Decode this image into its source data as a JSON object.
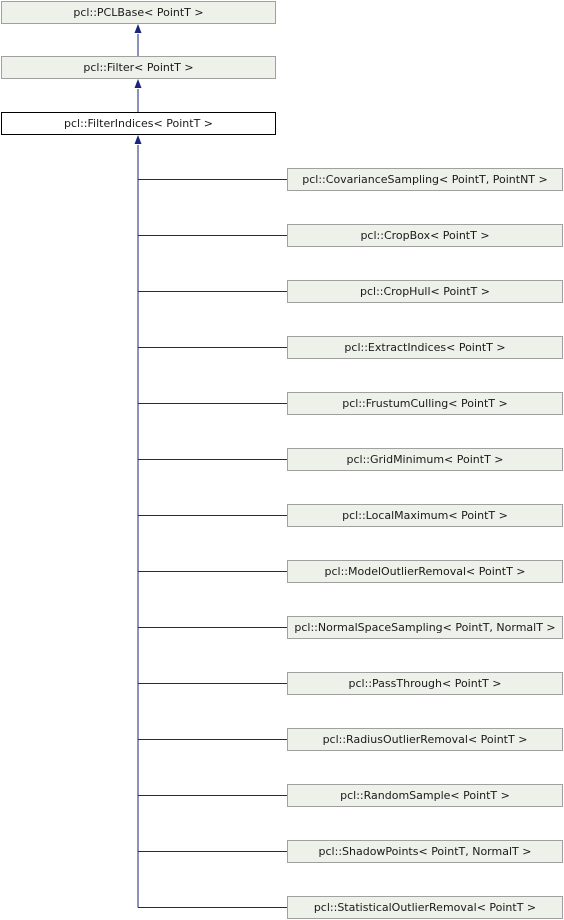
{
  "ancestors": [
    {
      "label": "pcl::PCLBase< PointT >"
    },
    {
      "label": "pcl::Filter< PointT >"
    }
  ],
  "current": {
    "label": "pcl::FilterIndices< PointT >"
  },
  "children": [
    {
      "label": "pcl::CovarianceSampling< PointT, PointNT >"
    },
    {
      "label": "pcl::CropBox< PointT >"
    },
    {
      "label": "pcl::CropHull< PointT >"
    },
    {
      "label": "pcl::ExtractIndices< PointT >"
    },
    {
      "label": "pcl::FrustumCulling< PointT >"
    },
    {
      "label": "pcl::GridMinimum< PointT >"
    },
    {
      "label": "pcl::LocalMaximum< PointT >"
    },
    {
      "label": "pcl::ModelOutlierRemoval< PointT >"
    },
    {
      "label": "pcl::NormalSpaceSampling< PointT, NormalT >"
    },
    {
      "label": "pcl::PassThrough< PointT >"
    },
    {
      "label": "pcl::RadiusOutlierRemoval< PointT >"
    },
    {
      "label": "pcl::RandomSample< PointT >"
    },
    {
      "label": "pcl::ShadowPoints< PointT, NormalT >"
    },
    {
      "label": "pcl::StatisticalOutlierRemoval< PointT >"
    }
  ],
  "colors": {
    "edge": "#1a237e",
    "node_fill": "#eef0ea",
    "node_border": "#a0a0a0",
    "current_border": "#000000"
  }
}
